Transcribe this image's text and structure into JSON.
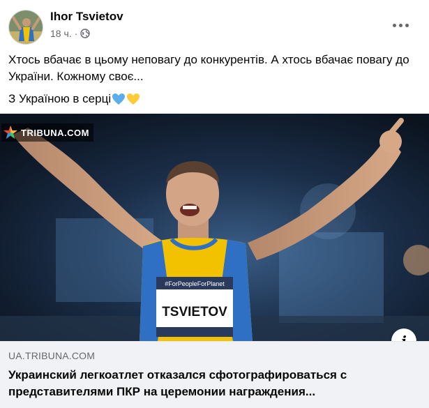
{
  "post": {
    "author": "Ihor Tsvietov",
    "time": "18 ч.",
    "separator": "·",
    "text_line1": "Хтось вбачає в цьому неповагу до конкурентів. А хтось вбачає повагу до України. Кожному своє...",
    "text_line2": "З Україною в серці",
    "icons": {
      "privacy": "globe-icon",
      "menu": "more-options-icon",
      "emoji": [
        "blue-heart-icon",
        "yellow-heart-icon"
      ]
    }
  },
  "image": {
    "watermark": "TRIBUNA.COM",
    "bib_name": "TSVIETOV",
    "bib_sponsor": "#ForPeopleForPlanet",
    "info_label": "i"
  },
  "link_preview": {
    "domain": "UA.TRIBUNA.COM",
    "title": "Украинский легкоатлет отказался сфотографироваться с представителями ПКР на церемонии награждения..."
  },
  "colors": {
    "text": "#050505",
    "secondary": "#65676b",
    "preview_bg": "#f0f2f5",
    "jersey_yellow": "#f2c200",
    "jersey_blue": "#2f6fc4"
  }
}
